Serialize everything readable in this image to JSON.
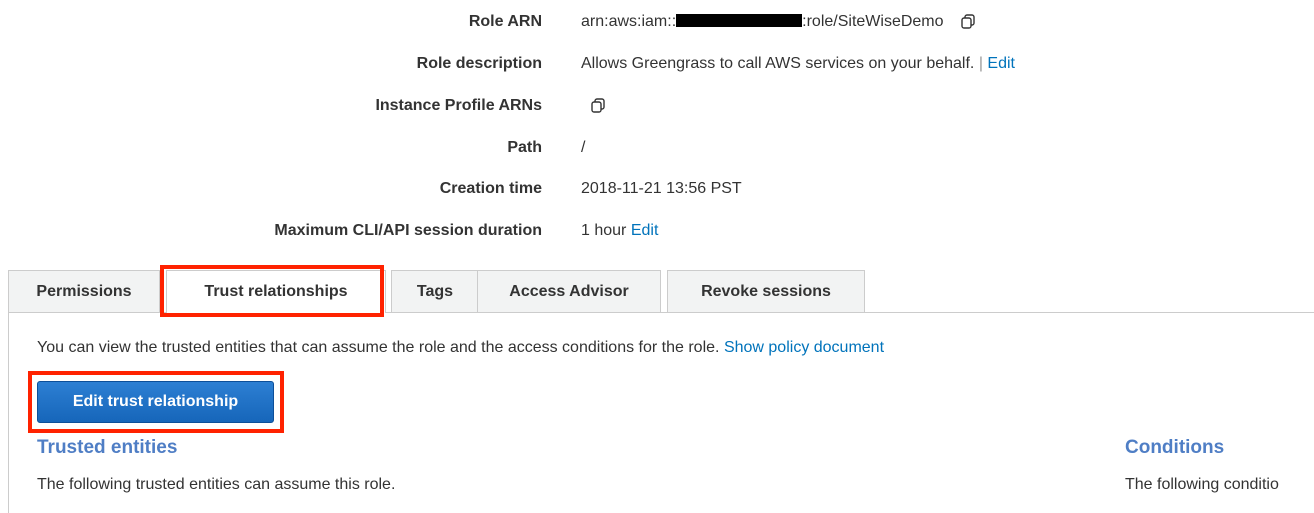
{
  "summary": {
    "role_arn": {
      "label": "Role ARN",
      "value_prefix": "arn:aws:iam::",
      "value_suffix": ":role/SiteWiseDemo"
    },
    "role_description": {
      "label": "Role description",
      "value": "Allows Greengrass to call AWS services on your behalf.",
      "separator": "|",
      "edit_label": "Edit"
    },
    "instance_profile_arns": {
      "label": "Instance Profile ARNs"
    },
    "path": {
      "label": "Path",
      "value": "/"
    },
    "creation_time": {
      "label": "Creation time",
      "value": "2018-11-21 13:56 PST"
    },
    "max_session": {
      "label": "Maximum CLI/API session duration",
      "value": "1 hour",
      "edit_label": "Edit"
    }
  },
  "tabs": [
    {
      "label": "Permissions"
    },
    {
      "label": "Trust relationships",
      "active": true
    },
    {
      "label": "Tags"
    },
    {
      "label": "Access Advisor"
    },
    {
      "label": "Revoke sessions"
    }
  ],
  "trust": {
    "intro_text": "You can view the trusted entities that can assume the role and the access conditions for the role.",
    "show_policy_label": "Show policy document",
    "edit_button_label": "Edit trust relationship",
    "trusted_entities_heading": "Trusted entities",
    "trusted_entities_text": "The following trusted entities can assume this role.",
    "conditions_heading": "Conditions",
    "conditions_text": "The following conditio"
  },
  "icons": {
    "copy": "copy-icon"
  },
  "colors": {
    "link": "#0073bb",
    "highlight": "#ff2200",
    "primary_button": "#1f6fc5",
    "heading": "#4f7ec5"
  }
}
